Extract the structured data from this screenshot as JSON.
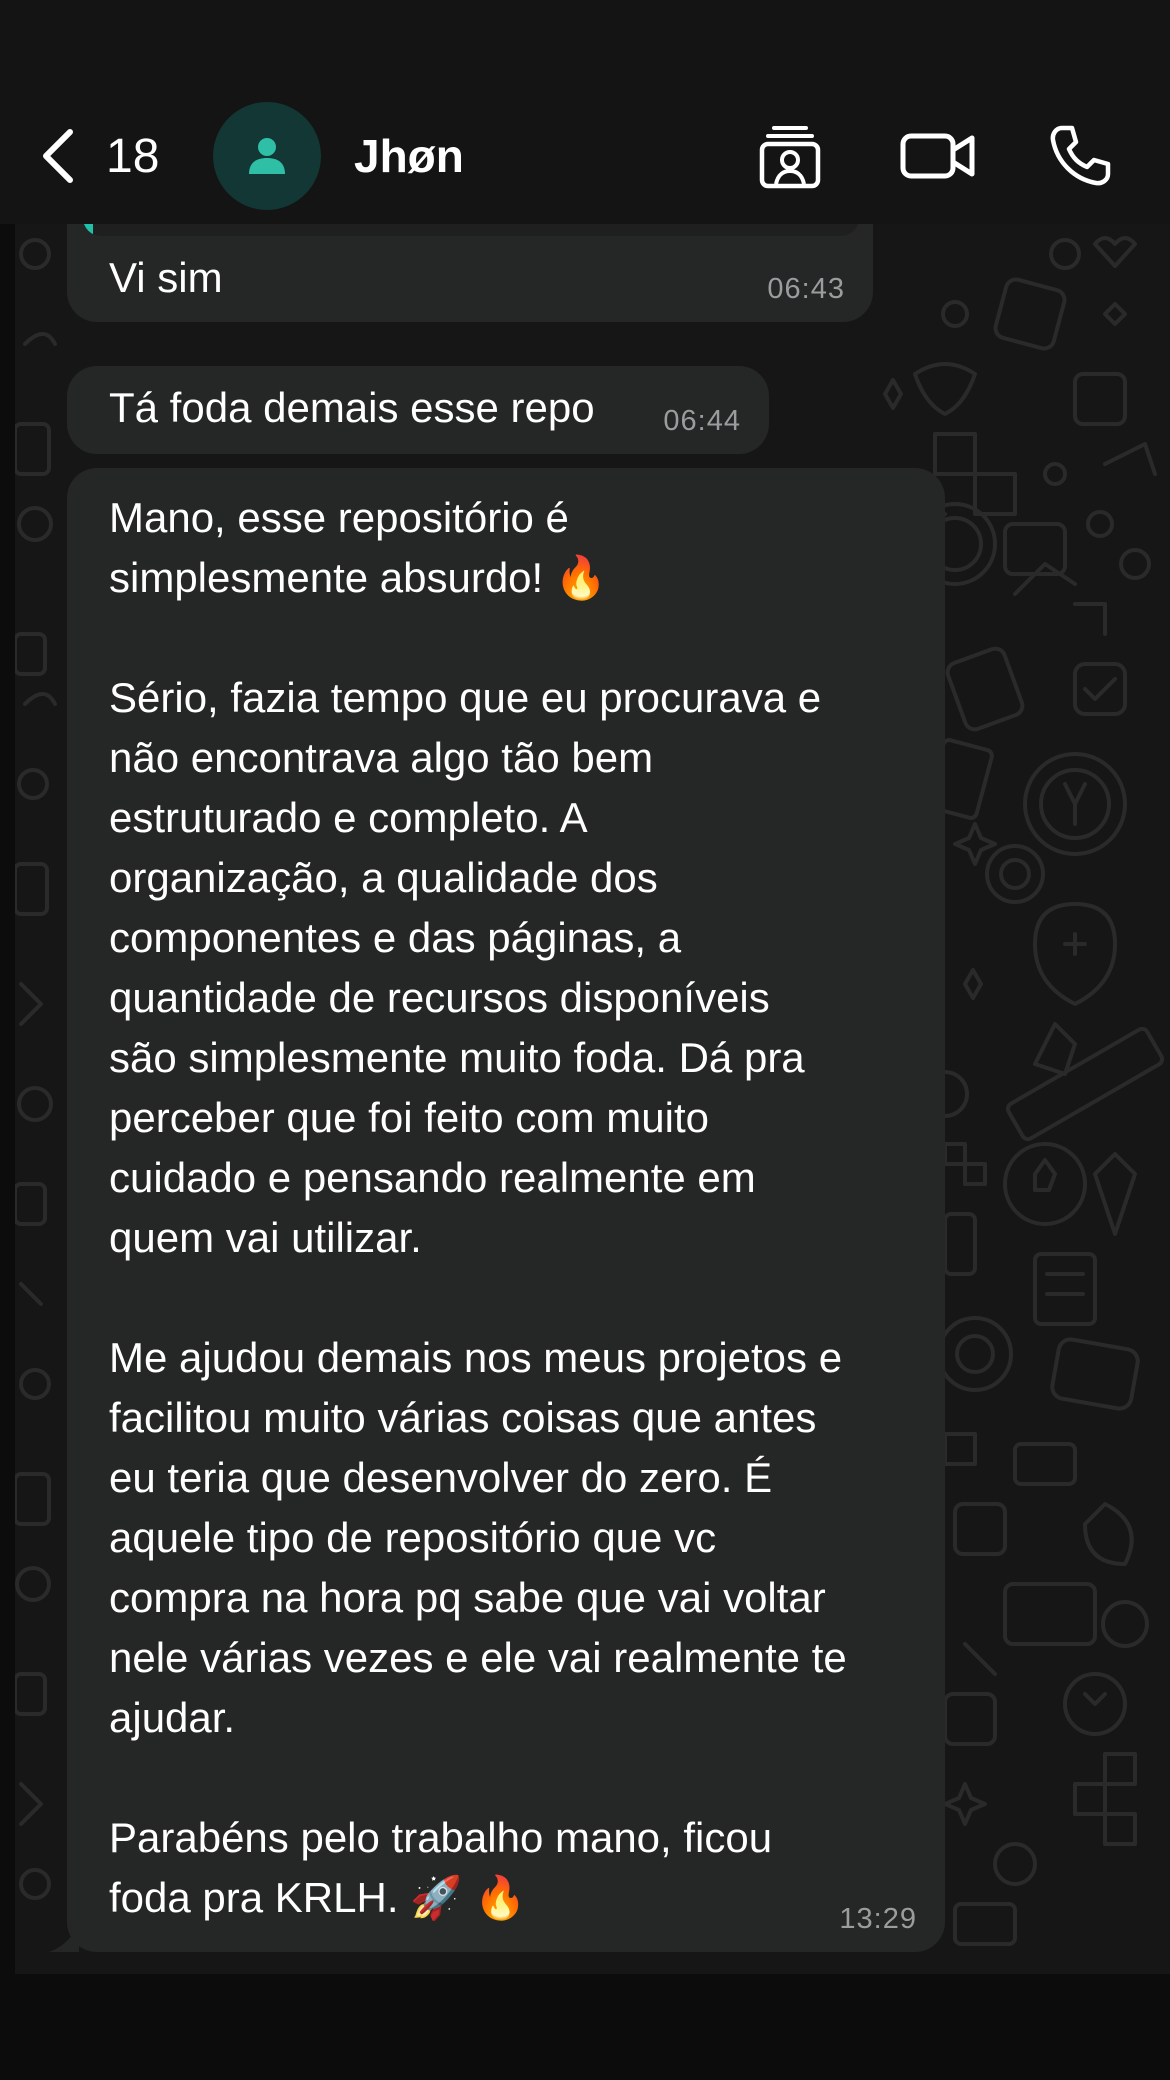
{
  "header": {
    "back_count": "18",
    "contact_name": "Jhøn",
    "icons": [
      "chevron-left-icon",
      "person-avatar-icon",
      "contact-card-icon",
      "video-call-icon",
      "phone-icon"
    ]
  },
  "colors": {
    "header_bg": "#141414",
    "chat_bg": "#161616",
    "bubble_bg": "#252626",
    "accent_teal": "#21c0a9",
    "avatar_bg": "#123734",
    "time_text": "#9a9d9e"
  },
  "messages": [
    {
      "text": "Vi sim",
      "time": "06:43"
    },
    {
      "text": "Tá foda demais esse repo",
      "time": "06:44"
    },
    {
      "text": "Mano, esse repositório é\nsimplesmente absurdo! 🔥\n\nSério, fazia tempo que eu procurava e\nnão encontrava algo tão bem\nestruturado e completo. A\norganização, a qualidade dos\ncomponentes e das páginas, a\nquantidade de recursos disponíveis\nsão simplesmente muito foda. Dá pra\nperceber que foi feito com muito\ncuidado e pensando realmente em\nquem vai utilizar.\n\nMe ajudou demais nos meus projetos e\nfacilitou muito várias coisas que antes\neu teria que desenvolver do zero. É\naquele tipo de repositório que vc\ncompra na hora pq sabe que vai voltar\nnele várias vezes e ele vai realmente te\najudar.\n\nParabéns pelo trabalho mano, ficou\nfoda pra KRLH. 🚀 🔥",
      "time": "13:29"
    }
  ]
}
